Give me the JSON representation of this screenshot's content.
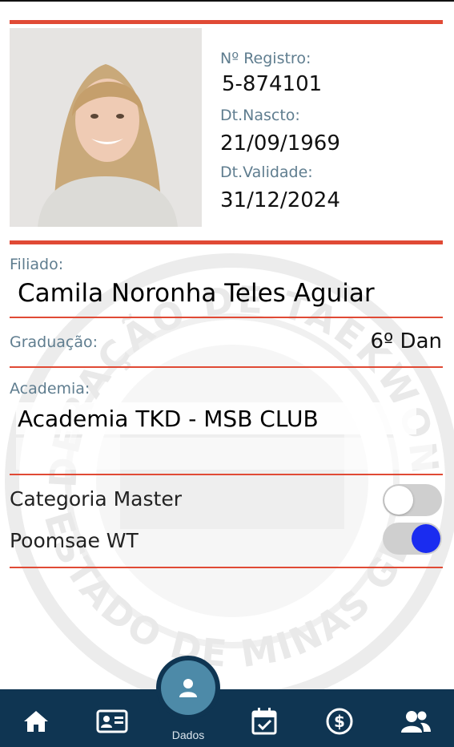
{
  "card": {
    "registro_label": "Nº Registro:",
    "registro_value": "5-874101",
    "nascimento_label": "Dt.Nascto:",
    "nascimento_value": "21/09/1969",
    "validade_label": "Dt.Validade:",
    "validade_value": "31/12/2024",
    "filiado_label": "Filiado:",
    "filiado_value": "Camila Noronha Teles Aguiar",
    "graduacao_label": "Graduação:",
    "graduacao_value": "6º Dan",
    "academia_label": "Academia:",
    "academia_value": "Academia TKD - MSB CLUB"
  },
  "options": {
    "categoria_master_label": "Categoria Master",
    "categoria_master_on": false,
    "poomsae_label": "Poomsae WT",
    "poomsae_on": true
  },
  "watermark": {
    "top_text": "FEDERAÇÃO DE TAEKWONDO",
    "bottom_text": "DO ESTADO DE MINAS GERAIS"
  },
  "nav": {
    "items": [
      "home-icon",
      "id-card-icon",
      "user-icon",
      "calendar-check-icon",
      "dollar-icon",
      "users-icon"
    ],
    "active_label": "Dados"
  },
  "colors": {
    "accent": "#e04a35",
    "label": "#5f7d8f",
    "navbar": "#0f3552",
    "fab": "#4d8aa8",
    "toggle_on": "#1a2cf0"
  }
}
